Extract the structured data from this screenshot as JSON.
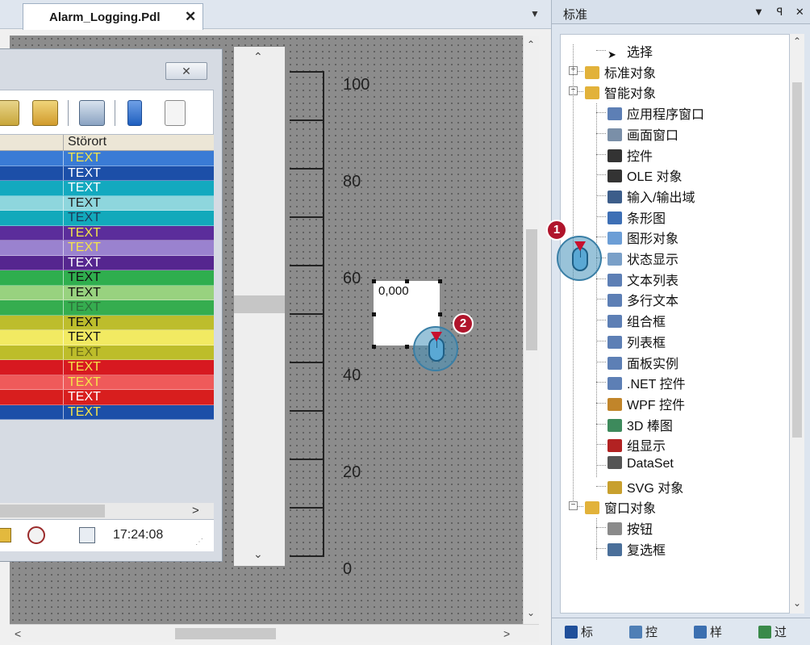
{
  "editor": {
    "tab_title": "Alarm_Logging.Pdl",
    "tab_close_glyph": "✕",
    "tab_dropdown_glyph": "▼"
  },
  "alarm_window": {
    "column_header": "Störort",
    "close_glyph": "✕",
    "rows": [
      {
        "color": "#3a7bd5",
        "text": "TEXT",
        "text_color": "#f5e44a"
      },
      {
        "color": "#1c4fa8",
        "text": "TEXT",
        "text_color": "#ffffff"
      },
      {
        "color": "#13a9bf",
        "text": "TEXT",
        "text_color": "#ffffff"
      },
      {
        "color": "#8ed6dd",
        "text": "TEXT",
        "text_color": "#222222"
      },
      {
        "color": "#12a9bb",
        "text": "TEXT",
        "text_color": "#1e3a5a"
      },
      {
        "color": "#5b2d9b",
        "text": "TEXT",
        "text_color": "#f5e44a"
      },
      {
        "color": "#9a82cf",
        "text": "TEXT",
        "text_color": "#f5e44a"
      },
      {
        "color": "#55268f",
        "text": "TEXT",
        "text_color": "#ffffff"
      },
      {
        "color": "#2fae4e",
        "text": "TEXT",
        "text_color": "#111111"
      },
      {
        "color": "#98d27f",
        "text": "TEXT",
        "text_color": "#111111"
      },
      {
        "color": "#35ad4f",
        "text": "TEXT",
        "text_color": "#2d6f3a"
      },
      {
        "color": "#bdbd2c",
        "text": "TEXT",
        "text_color": "#111111"
      },
      {
        "color": "#f2ea62",
        "text": "TEXT",
        "text_color": "#111111"
      },
      {
        "color": "#bdbd2a",
        "text": "TEXT",
        "text_color": "#6b6b18"
      },
      {
        "color": "#d71920",
        "text": "TEXT",
        "text_color": "#f5e44a"
      },
      {
        "color": "#ef5a5a",
        "text": "TEXT",
        "text_color": "#f5e44a"
      },
      {
        "color": "#d81e1e",
        "text": "TEXT",
        "text_color": "#ffffff"
      },
      {
        "color": "#1c4fa8",
        "text": "TEXT",
        "text_color": "#f5e44a"
      }
    ],
    "status_time": "17:24:08",
    "scroll_right_glyph": ">"
  },
  "scale": {
    "labels": [
      "100",
      "80",
      "60",
      "40",
      "20",
      "0"
    ]
  },
  "io_field": {
    "value": "0,000"
  },
  "panel": {
    "title": "标准",
    "controls": "▼ ꟼ ✕",
    "tree": [
      {
        "label": "选择",
        "icon": "cursor-icon",
        "level": 1
      },
      {
        "label": "标准对象",
        "icon": "folder-icon",
        "level": 0,
        "expander": "+"
      },
      {
        "label": "智能对象",
        "icon": "folder-open-icon",
        "level": 0,
        "expander": "−"
      },
      {
        "label": "应用程序窗口",
        "icon": "app-window-icon",
        "level": 1
      },
      {
        "label": "画面窗口",
        "icon": "picture-window-icon",
        "level": 1
      },
      {
        "label": "控件",
        "icon": "ocx-icon",
        "level": 1
      },
      {
        "label": "OLE 对象",
        "icon": "ole-icon",
        "level": 1
      },
      {
        "label": "输入/输出域",
        "icon": "io-field-icon",
        "level": 1
      },
      {
        "label": "条形图",
        "icon": "bar-icon",
        "level": 1
      },
      {
        "label": "图形对象",
        "icon": "graphic-icon",
        "level": 1
      },
      {
        "label": "状态显示",
        "icon": "status-icon",
        "level": 1
      },
      {
        "label": "文本列表",
        "icon": "text-list-icon",
        "level": 1
      },
      {
        "label": "多行文本",
        "icon": "multiline-icon",
        "level": 1
      },
      {
        "label": "组合框",
        "icon": "combo-icon",
        "level": 1
      },
      {
        "label": "列表框",
        "icon": "listbox-icon",
        "level": 1
      },
      {
        "label": "面板实例",
        "icon": "faceplate-icon",
        "level": 1
      },
      {
        "label": ".NET 控件",
        "icon": "dotnet-icon",
        "level": 1
      },
      {
        "label": "WPF 控件",
        "icon": "wpf-icon",
        "level": 1
      },
      {
        "label": "3D 棒图",
        "icon": "3d-bar-icon",
        "level": 1
      },
      {
        "label": "组显示",
        "icon": "group-display-icon",
        "level": 1
      },
      {
        "label": "DataSet",
        "icon": "dataset-icon",
        "level": 1
      },
      {
        "label": "SVG 对象",
        "icon": "svg-icon",
        "level": 1
      },
      {
        "label": "窗口对象",
        "icon": "folder-open-icon",
        "level": 0,
        "expander": "−"
      },
      {
        "label": "按钮",
        "icon": "button-icon",
        "level": 1
      },
      {
        "label": "复选框",
        "icon": "checkbox-icon",
        "level": 1
      }
    ],
    "bottom_tabs": [
      {
        "label": "标",
        "icon": "standard-tab-icon"
      },
      {
        "label": "控",
        "icon": "controls-tab-icon"
      },
      {
        "label": "样",
        "icon": "styles-tab-icon"
      },
      {
        "label": "过",
        "icon": "dynamic-tab-icon"
      }
    ]
  },
  "callouts": [
    {
      "step": "1"
    },
    {
      "step": "2"
    }
  ]
}
